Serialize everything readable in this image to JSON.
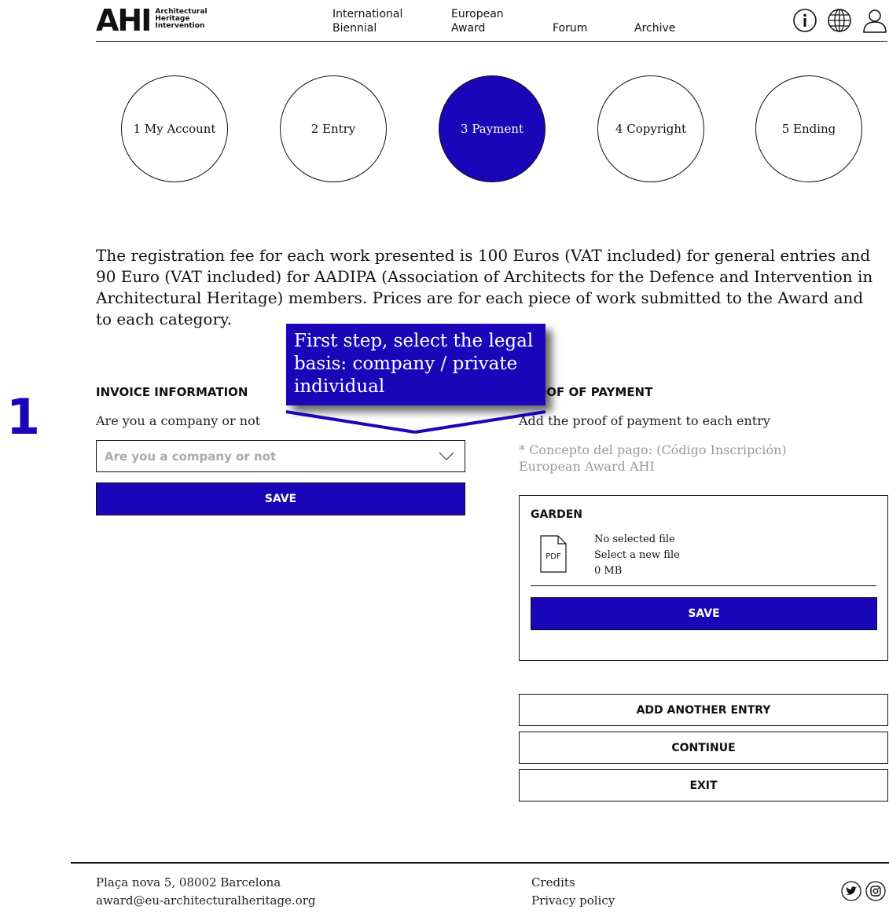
{
  "header": {
    "logo_mark": "AHI",
    "logo_text": [
      "Architectural",
      "Heritage",
      "Intervention"
    ],
    "nav": [
      {
        "line1": "International",
        "line2": "Biennial"
      },
      {
        "line1": "European",
        "line2": "Award"
      },
      {
        "line1": "",
        "line2": "Forum"
      },
      {
        "line1": "",
        "line2": "Archive"
      }
    ],
    "icons": [
      "info-icon",
      "globe-icon",
      "user-icon"
    ]
  },
  "steps": [
    {
      "label": "1 My Account",
      "active": false
    },
    {
      "label": "2 Entry",
      "active": false
    },
    {
      "label": "3 Payment",
      "active": true
    },
    {
      "label": "4 Copyright",
      "active": false
    },
    {
      "label": "5 Ending",
      "active": false
    }
  ],
  "intro": "The registration fee for each work presented is 100 Euros (VAT included) for general entries and 90 Euro (VAT included) for AADIPA (Association of Architects for the Defence and Intervention in Architectural Heritage) members. Prices are for each piece of work submitted to the Award and to each category.",
  "marker": "1",
  "tooltip": "First step, select the legal basis: company / private individual",
  "invoice": {
    "title": "INVOICE INFORMATION",
    "question": "Are you a company or not",
    "select_placeholder": "Are you a company or not",
    "save_label": "SAVE"
  },
  "payment": {
    "title": "PROOF OF PAYMENT",
    "instruction": "Add the proof of payment to each entry",
    "note": "* Concepto del pago: (Código Inscripción) European Award AHI",
    "entry": {
      "title": "GARDEN",
      "file_type": "PDF",
      "file_status": "No selected file",
      "file_action": "Select a new file",
      "file_size": "0 MB",
      "save_label": "SAVE"
    }
  },
  "actions": {
    "add_entry": "ADD ANOTHER ENTRY",
    "continue": "CONTINUE",
    "exit": "EXIT"
  },
  "footer": {
    "address": "Plaça nova 5, 08002 Barcelona",
    "email": "award@eu-architecturalheritage.org",
    "credits": "Credits",
    "privacy": "Privacy policy",
    "social": [
      "twitter-icon",
      "instagram-icon"
    ]
  },
  "colors": {
    "accent": "#1a06b8",
    "text": "#111111",
    "muted": "#999999"
  }
}
